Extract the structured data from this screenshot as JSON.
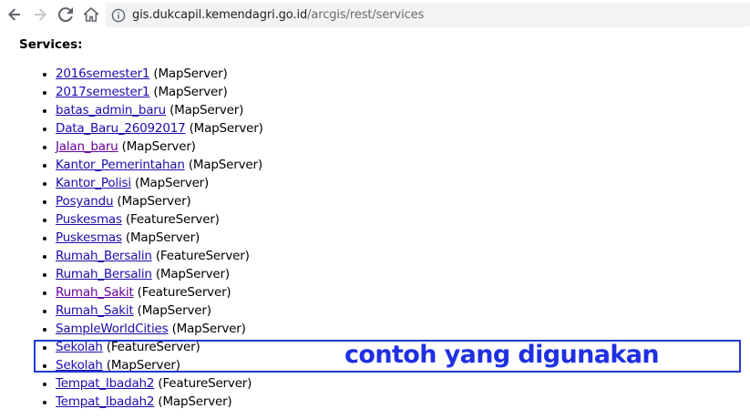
{
  "browser": {
    "url_domain": "gis.dukcapil.kemendagri.go.id",
    "url_path": "/arcgis/rest/services",
    "icons": [
      "back-arrow-icon",
      "forward-arrow-icon",
      "reload-icon",
      "home-icon",
      "info-icon"
    ]
  },
  "page": {
    "heading": "Services:",
    "services": [
      {
        "name": "2016semester1",
        "type": "(MapServer)",
        "visited": false
      },
      {
        "name": "2017semester1",
        "type": "(MapServer)",
        "visited": false
      },
      {
        "name": "batas_admin_baru",
        "type": "(MapServer)",
        "visited": false
      },
      {
        "name": "Data_Baru_26092017",
        "type": "(MapServer)",
        "visited": false
      },
      {
        "name": "Jalan_baru",
        "type": "(MapServer)",
        "visited": true
      },
      {
        "name": "Kantor_Pemerintahan",
        "type": "(MapServer)",
        "visited": false
      },
      {
        "name": "Kantor_Polisi",
        "type": "(MapServer)",
        "visited": false
      },
      {
        "name": "Posyandu",
        "type": "(MapServer)",
        "visited": false
      },
      {
        "name": "Puskesmas",
        "type": "(FeatureServer)",
        "visited": false
      },
      {
        "name": "Puskesmas",
        "type": "(MapServer)",
        "visited": false
      },
      {
        "name": "Rumah_Bersalin",
        "type": "(FeatureServer)",
        "visited": false
      },
      {
        "name": "Rumah_Bersalin",
        "type": "(MapServer)",
        "visited": false
      },
      {
        "name": "Rumah_Sakit",
        "type": "(FeatureServer)",
        "visited": true
      },
      {
        "name": "Rumah_Sakit",
        "type": "(MapServer)",
        "visited": false
      },
      {
        "name": "SampleWorldCities",
        "type": "(MapServer)",
        "visited": false
      },
      {
        "name": "Sekolah",
        "type": "(FeatureServer)",
        "visited": false
      },
      {
        "name": "Sekolah",
        "type": "(MapServer)",
        "visited": false
      },
      {
        "name": "Tempat_Ibadah2",
        "type": "(FeatureServer)",
        "visited": false
      },
      {
        "name": "Tempat_Ibadah2",
        "type": "(MapServer)",
        "visited": false
      }
    ],
    "annotation": "contoh yang digunakan"
  },
  "colors": {
    "link": "#1a0dab",
    "link_visited": "#660099",
    "annotation": "#1f2fe3",
    "highlight_border": "#1f3bd1"
  }
}
